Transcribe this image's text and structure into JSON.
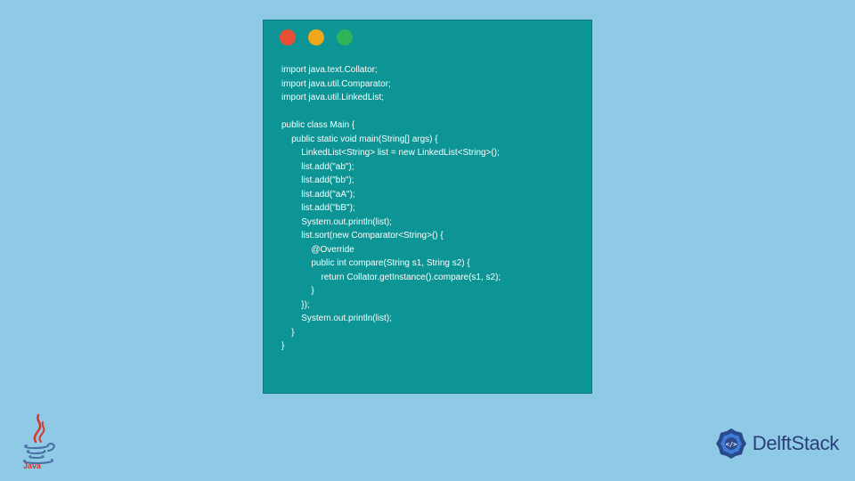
{
  "code": {
    "lines": [
      "import java.text.Collator;",
      "import java.util.Comparator;",
      "import java.util.LinkedList;",
      "",
      "public class Main {",
      "    public static void main(String[] args) {",
      "        LinkedList<String> list = new LinkedList<String>();",
      "        list.add(\"ab\");",
      "        list.add(\"bb\");",
      "        list.add(\"aA\");",
      "        list.add(\"bB\");",
      "        System.out.println(list);",
      "        list.sort(new Comparator<String>() {",
      "            @Override",
      "            public int compare(String s1, String s2) {",
      "                return Collator.getInstance().compare(s1, s2);",
      "            }",
      "        });",
      "        System.out.println(list);",
      "    }",
      "}"
    ]
  },
  "brand": {
    "name": "DelftStack"
  },
  "colors": {
    "bg": "#8ecae6",
    "window": "#0d9494",
    "red": "#e94f37",
    "yellow": "#f2a71b",
    "green": "#2fb457",
    "brand": "#2c3e7a"
  }
}
